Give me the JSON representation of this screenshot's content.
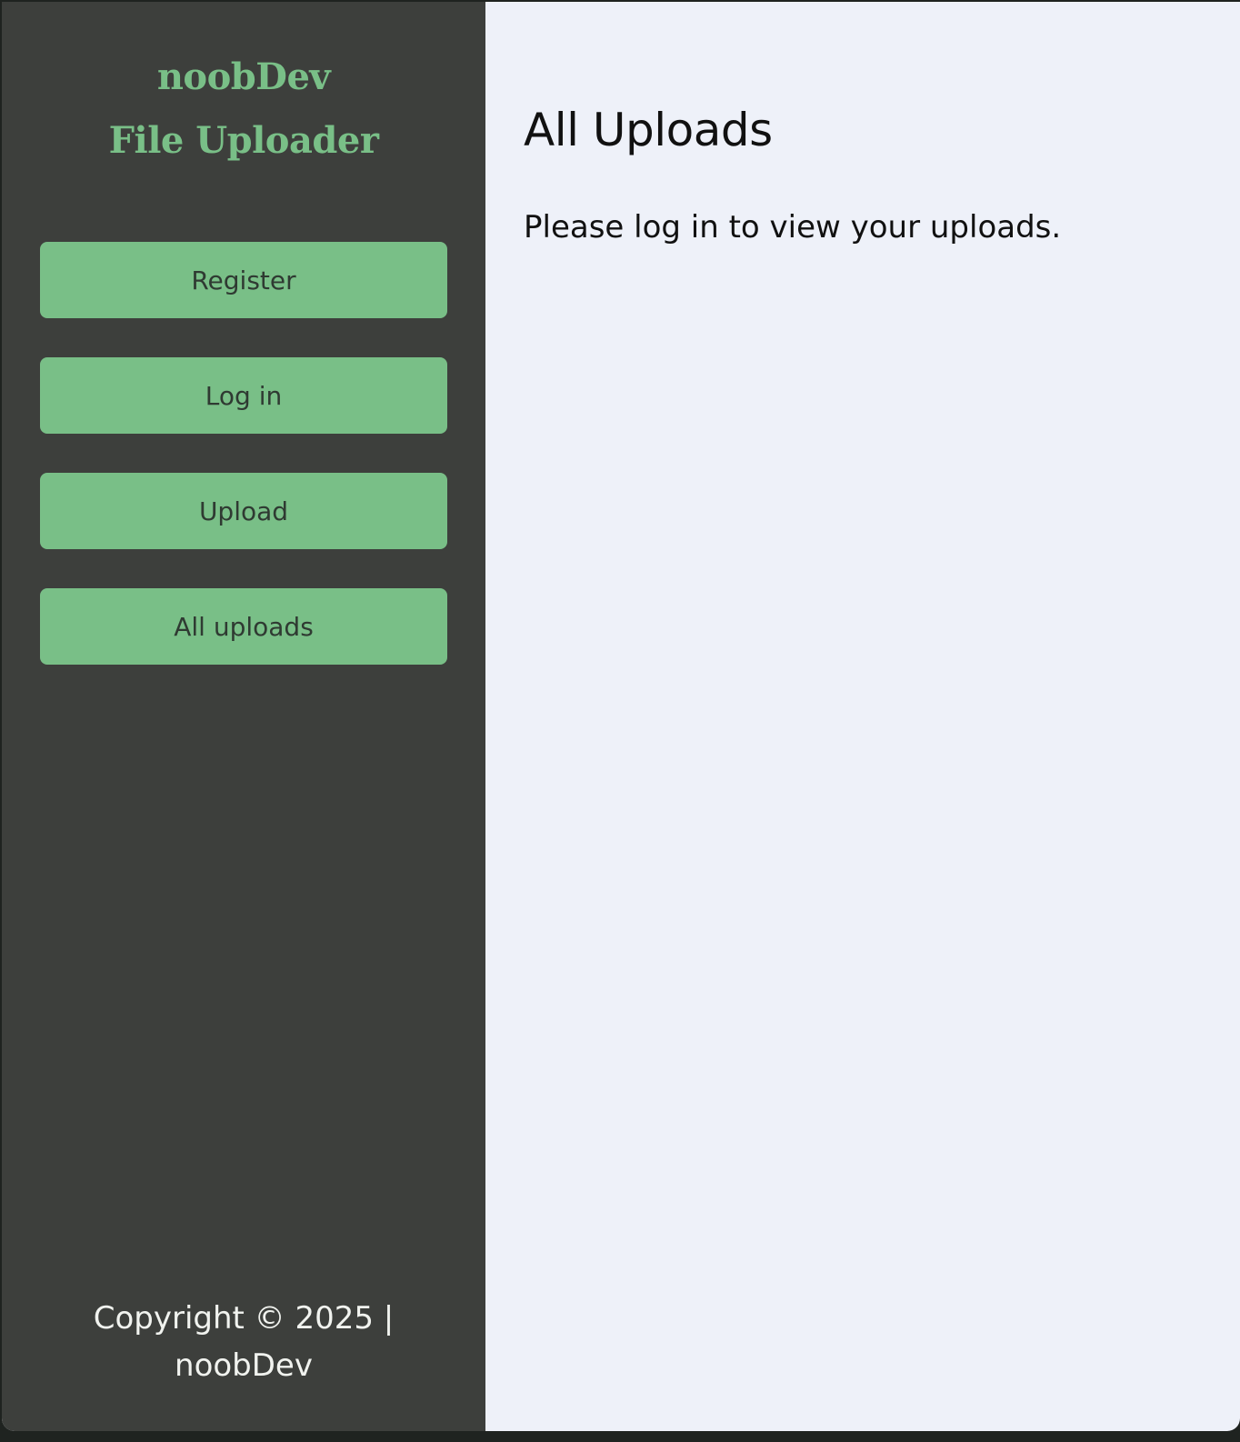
{
  "sidebar": {
    "brand_line1": "noobDev",
    "brand_line2": "File Uploader",
    "nav": [
      {
        "label": "Register"
      },
      {
        "label": "Log in"
      },
      {
        "label": "Upload"
      },
      {
        "label": "All uploads"
      }
    ],
    "footer_line1": "Copyright © 2025 |",
    "footer_line2": "noobDev"
  },
  "main": {
    "title": "All Uploads",
    "message": "Please log in to view your uploads."
  },
  "colors": {
    "sidebar_bg": "#3d3f3c",
    "accent_green": "#79bf87",
    "main_bg": "#eef1f9"
  }
}
